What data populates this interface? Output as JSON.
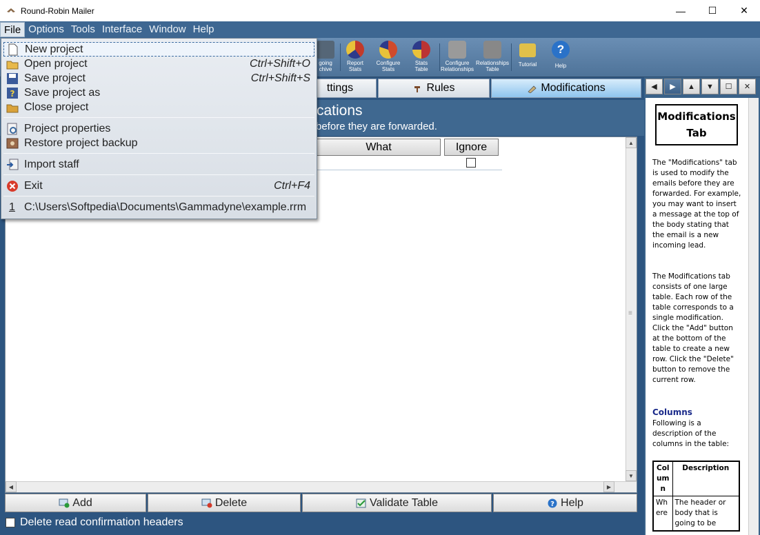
{
  "window": {
    "title": "Round-Robin Mailer",
    "minimize": "—",
    "maximize": "☐",
    "close": "✕"
  },
  "menubar": [
    "File",
    "Options",
    "Tools",
    "Interface",
    "Window",
    "Help"
  ],
  "toolbar": {
    "buttons": [
      {
        "label": "going\nchive",
        "icon": "archive-icon",
        "color": "#556677"
      },
      {
        "label": "Report\nStats",
        "icon": "report-stats-icon",
        "color": "#c23a2a"
      },
      {
        "label": "Configure\nStats",
        "icon": "configure-stats-icon",
        "color": "#d04a2c"
      },
      {
        "label": "Stats\nTable",
        "icon": "stats-table-icon",
        "color": "#b33"
      },
      {
        "label": "Configure\nRelationships",
        "icon": "handshake-icon",
        "color": "#8a8a8a"
      },
      {
        "label": "Relationships\nTable",
        "icon": "relationships-table-icon",
        "color": "#7a7a7a"
      },
      {
        "label": "Tutorial",
        "icon": "book-icon",
        "color": "#d9b43a"
      },
      {
        "label": "Help",
        "icon": "help-icon",
        "color": "#2a72c8"
      }
    ]
  },
  "tabs": {
    "settings": "ttings",
    "rules": "Rules",
    "modifications": "Modifications"
  },
  "content": {
    "title": "cations",
    "subtitle": "before they are forwarded."
  },
  "grid": {
    "columns": [
      "What",
      "Ignore"
    ]
  },
  "bottom_buttons": {
    "add": "Add",
    "delete": "Delete",
    "validate": "Validate Table",
    "help": "Help"
  },
  "checkbox": {
    "label": "Delete read confirmation headers",
    "checked": false
  },
  "file_menu": {
    "items": [
      {
        "label": "New project",
        "shortcut": "",
        "icon": "new-document-icon",
        "highlighted": true
      },
      {
        "label": "Open project",
        "shortcut": "Ctrl+Shift+O",
        "icon": "open-folder-icon"
      },
      {
        "label": "Save project",
        "shortcut": "Ctrl+Shift+S",
        "icon": "save-disk-icon"
      },
      {
        "label": "Save project as",
        "shortcut": "",
        "icon": "save-as-icon"
      },
      {
        "label": "Close project",
        "shortcut": "",
        "icon": "close-folder-icon"
      },
      {
        "label": "Project properties",
        "shortcut": "",
        "icon": "properties-icon"
      },
      {
        "label": "Restore project backup",
        "shortcut": "",
        "icon": "backup-icon"
      },
      {
        "label": "Import staff",
        "shortcut": "",
        "icon": "import-icon"
      },
      {
        "label": "Exit",
        "shortcut": "Ctrl+F4",
        "icon": "exit-icon"
      }
    ],
    "recent": {
      "number": "1",
      "path": "C:\\Users\\Softpedia\\Documents\\Gammadyne\\example.rrm"
    }
  },
  "help_pane": {
    "title": "Modifications Tab",
    "para1": "The \"Modifications\" tab is used to modify the emails before they are forwarded.  For example, you may want to insert a message at the top of the body stating that the email is a new incoming lead.",
    "para2": "The Modifications tab consists of one large table.  Each row of the table corresponds to a single modification.  Click the \"Add\" button at the bottom of the table to create a new row.  Click the \"Delete\" button to remove the current row.",
    "columns_heading": "Columns",
    "para3": "Following is a description of the columns in the table:",
    "table_head": [
      "Col um n",
      "Description"
    ],
    "table_row": [
      "Wh ere",
      "The header or body that is going to be"
    ]
  }
}
